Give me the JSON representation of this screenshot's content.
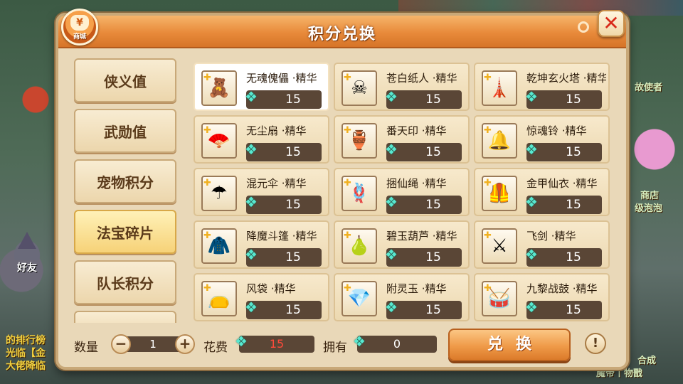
{
  "dialog": {
    "title": "积分兑换",
    "shop_badge": {
      "symbol": "¥",
      "label": "商城"
    },
    "close_symbol": "✕"
  },
  "tabs": [
    {
      "label": "侠义值",
      "active": false
    },
    {
      "label": "武勋值",
      "active": false
    },
    {
      "label": "宠物积分",
      "active": false
    },
    {
      "label": "法宝碎片",
      "active": true
    },
    {
      "label": "队长积分",
      "active": false
    },
    {
      "label": "",
      "active": false
    }
  ],
  "items": [
    {
      "name": "无魂傀儡 ·精华",
      "price": "15",
      "icon": "puppet-icon",
      "glyph": "🧸",
      "selected": true
    },
    {
      "name": "苍白纸人 ·精华",
      "price": "15",
      "icon": "paper-doll-icon",
      "glyph": "☠",
      "selected": false
    },
    {
      "name": "乾坤玄火塔 ·精华",
      "price": "15",
      "icon": "fire-tower-icon",
      "glyph": "🗼",
      "selected": false
    },
    {
      "name": "无尘扇 ·精华",
      "price": "15",
      "icon": "fan-icon",
      "glyph": "🪭",
      "selected": false
    },
    {
      "name": "番天印 ·精华",
      "price": "15",
      "icon": "seal-icon",
      "glyph": "🏺",
      "selected": false
    },
    {
      "name": "惊魂铃 ·精华",
      "price": "15",
      "icon": "bell-icon",
      "glyph": "🔔",
      "selected": false
    },
    {
      "name": "混元伞 ·精华",
      "price": "15",
      "icon": "umbrella-icon",
      "glyph": "☂",
      "selected": false
    },
    {
      "name": "捆仙绳 ·精华",
      "price": "15",
      "icon": "rope-icon",
      "glyph": "🪢",
      "selected": false
    },
    {
      "name": "金甲仙衣 ·精华",
      "price": "15",
      "icon": "armor-icon",
      "glyph": "🦺",
      "selected": false
    },
    {
      "name": "降魔斗篷 ·精华",
      "price": "15",
      "icon": "cloak-icon",
      "glyph": "🧥",
      "selected": false
    },
    {
      "name": "碧玉葫芦 ·精华",
      "price": "15",
      "icon": "gourd-icon",
      "glyph": "🍐",
      "selected": false
    },
    {
      "name": "飞剑 ·精华",
      "price": "15",
      "icon": "sword-icon",
      "glyph": "⚔",
      "selected": false
    },
    {
      "name": "风袋 ·精华",
      "price": "15",
      "icon": "wind-bag-icon",
      "glyph": "👝",
      "selected": false
    },
    {
      "name": "附灵玉 ·精华",
      "price": "15",
      "icon": "jade-icon",
      "glyph": "💎",
      "selected": false
    },
    {
      "name": "九黎战鼓 ·精华",
      "price": "15",
      "icon": "drum-icon",
      "glyph": "🥁",
      "selected": false
    }
  ],
  "bottom": {
    "quantity_label": "数量",
    "quantity": "1",
    "minus": "−",
    "plus": "+",
    "cost_label": "花费",
    "cost": "15",
    "owned_label": "拥有",
    "owned": "0",
    "exchange_label": "兑换",
    "info_symbol": "!"
  },
  "background": {
    "friends_label": "好友",
    "side_texts": [
      "的排行榜",
      "光临【金",
      "大佬降临",
      "魔帝丨物戬",
      "合成",
      "商店",
      "级泡泡",
      "故使者"
    ]
  },
  "colors": {
    "title_orange": "#e88a3a",
    "panel_bg": "#e9d8b8",
    "cost_red": "#ff4a3a",
    "gem_cyan": "#58e8d0"
  }
}
